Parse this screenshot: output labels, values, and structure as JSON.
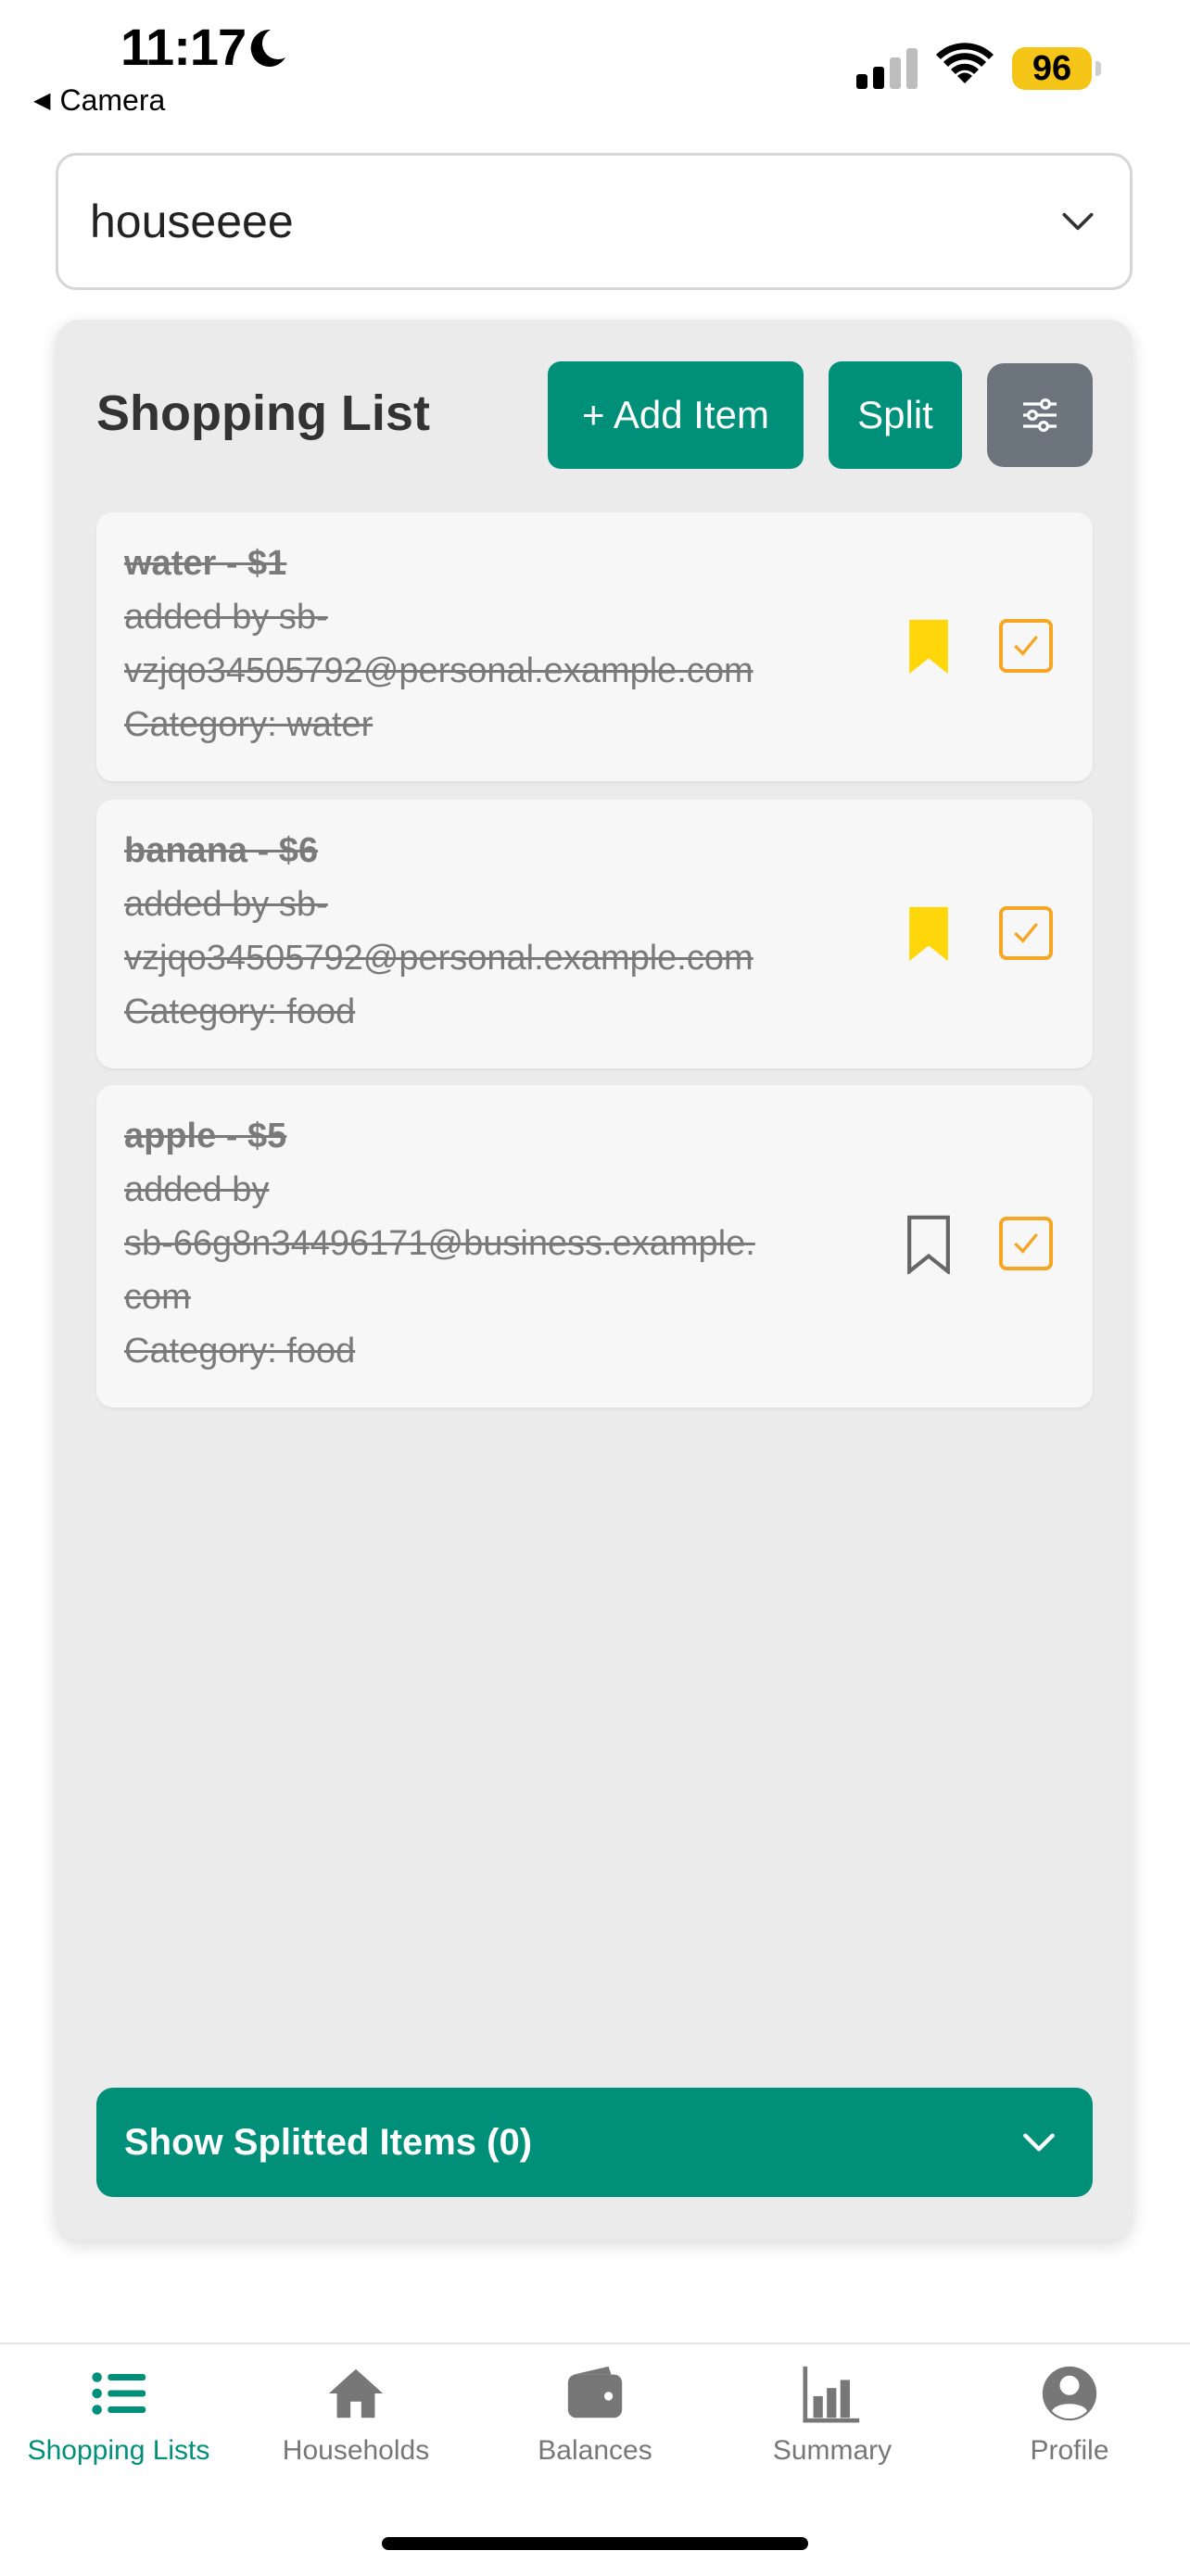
{
  "status_bar": {
    "time": "11:17",
    "back_label": "Camera",
    "battery": "96",
    "battery_color": "#f5c518"
  },
  "household_select": {
    "value": "houseeee"
  },
  "shopping_list": {
    "title": "Shopping List",
    "add_item_label": "+ Add Item",
    "split_label": "Split",
    "accent_color": "#00907a",
    "items": [
      {
        "title": "water - $1",
        "added_by_lines": [
          "added by sb-",
          "vzjqo34505792@personal.example.com"
        ],
        "category": "Category: water",
        "bookmarked": true,
        "checked": true
      },
      {
        "title": "banana - $6",
        "added_by_lines": [
          "added by sb-",
          "vzjqo34505792@personal.example.com"
        ],
        "category": "Category: food",
        "bookmarked": true,
        "checked": true
      },
      {
        "title": "apple - $5",
        "added_by_lines": [
          "added by",
          "sb-66g8n34496171@business.example.",
          "com"
        ],
        "category": "Category: food",
        "bookmarked": false,
        "checked": true
      }
    ],
    "show_splitted_label": "Show Splitted Items (0)"
  },
  "tab_bar": {
    "tabs": [
      {
        "label": "Shopping Lists",
        "icon": "list-icon",
        "active": true
      },
      {
        "label": "Households",
        "icon": "home-icon",
        "active": false
      },
      {
        "label": "Balances",
        "icon": "wallet-icon",
        "active": false
      },
      {
        "label": "Summary",
        "icon": "bar-chart-icon",
        "active": false
      },
      {
        "label": "Profile",
        "icon": "profile-icon",
        "active": false
      }
    ]
  }
}
